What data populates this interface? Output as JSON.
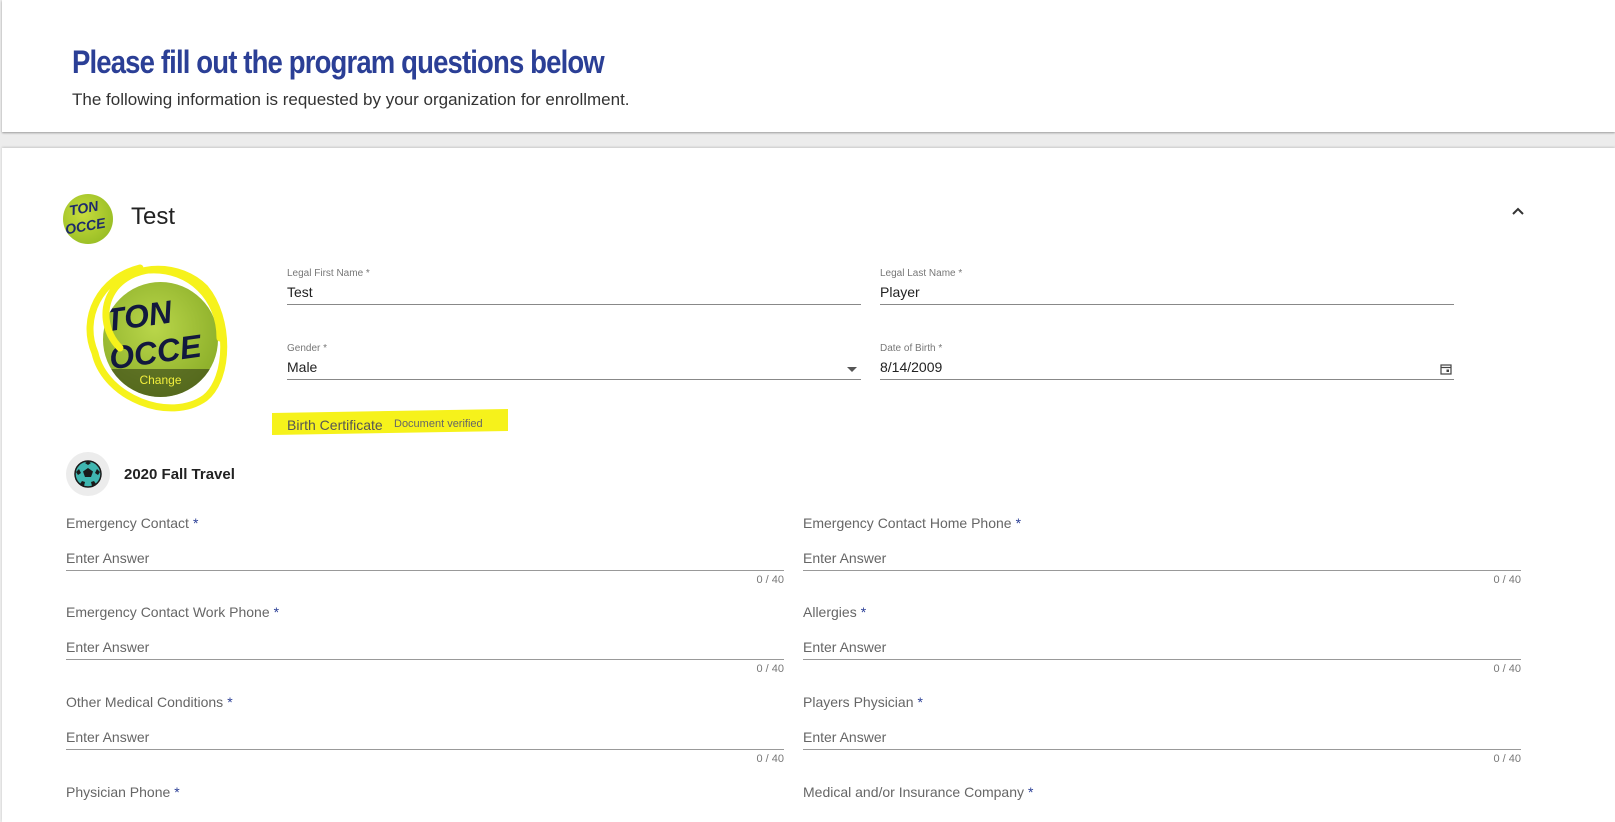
{
  "header": {
    "title": "Please fill out the program questions below",
    "subtitle": "The following information is requested by your organization for enrollment."
  },
  "player": {
    "name": "Test",
    "photo_change_label": "Change",
    "avatar_text_1": "TON",
    "avatar_text_2": "OCCE",
    "fields": {
      "first_name": {
        "label": "Legal First Name",
        "required": "*",
        "value": "Test"
      },
      "last_name": {
        "label": "Legal Last Name",
        "required": "*",
        "value": "Player"
      },
      "gender": {
        "label": "Gender",
        "required": "*",
        "value": "Male"
      },
      "dob": {
        "label": "Date of Birth",
        "required": "*",
        "value": "8/14/2009"
      }
    },
    "birth_certificate": {
      "label": "Birth Certificate",
      "status": "Document verified"
    }
  },
  "program": {
    "name": "2020 Fall Travel",
    "questions": [
      {
        "label": "Emergency Contact",
        "required": "*",
        "placeholder": "Enter Answer",
        "counter": "0 / 40"
      },
      {
        "label": "Emergency Contact Home Phone",
        "required": "*",
        "placeholder": "Enter Answer",
        "counter": "0 / 40"
      },
      {
        "label": "Emergency Contact Work Phone",
        "required": "*",
        "placeholder": "Enter Answer",
        "counter": "0 / 40"
      },
      {
        "label": "Allergies",
        "required": "*",
        "placeholder": "Enter Answer",
        "counter": "0 / 40"
      },
      {
        "label": "Other Medical Conditions",
        "required": "*",
        "placeholder": "Enter Answer",
        "counter": "0 / 40"
      },
      {
        "label": "Players Physician",
        "required": "*",
        "placeholder": "Enter Answer",
        "counter": "0 / 40"
      },
      {
        "label": "Physician Phone",
        "required": "*",
        "placeholder": "",
        "counter": ""
      },
      {
        "label": "Medical and/or Insurance Company",
        "required": "*",
        "placeholder": "",
        "counter": ""
      }
    ]
  },
  "colors": {
    "title_blue": "#2b3f96",
    "highlight_yellow": "#f6f21b",
    "avatar_green": "#9dc22a"
  }
}
